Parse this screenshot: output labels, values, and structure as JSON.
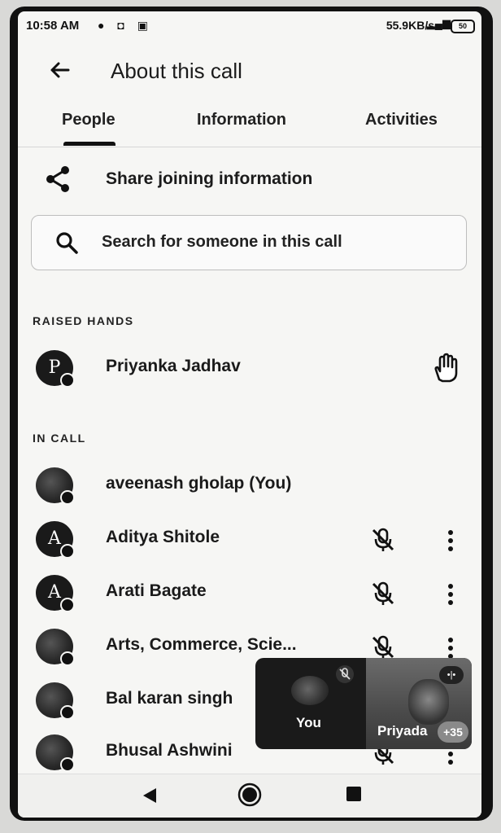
{
  "status_bar": {
    "time": "10:58 AM",
    "icons": [
      "dot-icon",
      "camera-icon",
      "facebook-icon"
    ],
    "net_speed": "55.9KB/s",
    "battery": "50"
  },
  "app_bar": {
    "title": "About this call"
  },
  "tabs": [
    {
      "label": "People",
      "selected": true
    },
    {
      "label": "Information",
      "selected": false
    },
    {
      "label": "Activities",
      "selected": false
    }
  ],
  "share": {
    "label": "Share joining information",
    "icon": "share-icon"
  },
  "search": {
    "placeholder": "Search for someone in this call",
    "icon": "search-icon"
  },
  "raised_hands": {
    "heading": "RAISED HANDS",
    "people": [
      {
        "name": "Priyanka Jadhav",
        "initial": "P",
        "icon": "raised-hand-icon"
      }
    ]
  },
  "in_call": {
    "heading": "IN CALL",
    "people": [
      {
        "name": "aveenash gholap (You)",
        "initial": "",
        "photo": true
      },
      {
        "name": "Aditya Shitole",
        "initial": "A",
        "muted": true
      },
      {
        "name": "Arati Bagate",
        "initial": "A",
        "muted": true
      },
      {
        "name": "Arts, Commerce, Scie...",
        "initial": "",
        "photo": true,
        "muted": true
      },
      {
        "name": "Bal karan singh",
        "initial": "",
        "photo": true
      },
      {
        "name": "Bhusal Ashwini",
        "initial": "",
        "photo": true,
        "muted": true
      }
    ]
  },
  "floating_view": {
    "you_label": "You",
    "other_label": "Priyada",
    "extra_count": "+35"
  },
  "colors": {
    "text": "#1a1a1a",
    "background": "#f6f6f4",
    "overlay": "#1a1a1a"
  }
}
